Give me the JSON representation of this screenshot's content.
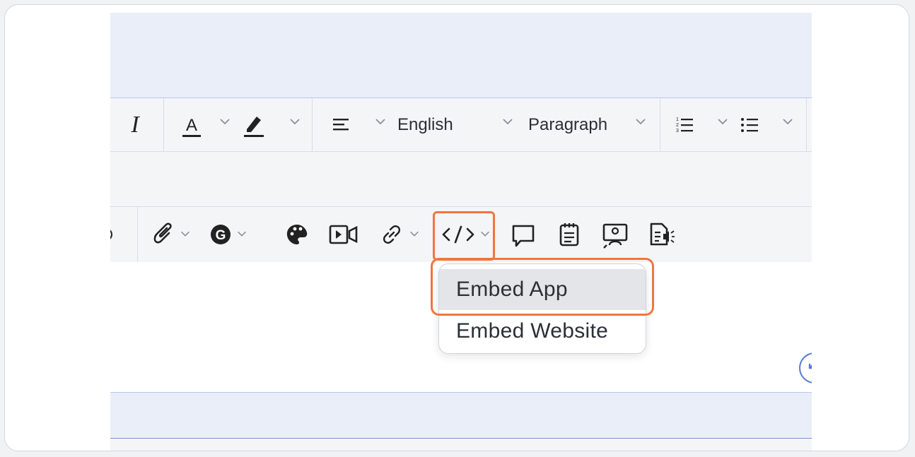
{
  "toolbar_row1": {
    "language_label": "English",
    "block_format_label": "Paragraph"
  },
  "embed_menu": {
    "items": [
      {
        "label": "Embed App",
        "highlighted": true
      },
      {
        "label": "Embed Website",
        "highlighted": false
      }
    ]
  },
  "icons": {
    "italic": "italic-icon",
    "font_color": "font-color-icon",
    "highlight_color": "highlighter-icon",
    "align": "align-left-icon",
    "ordered_list": "ordered-list-icon",
    "bullet_list": "bullet-list-icon",
    "attachment": "paperclip-icon",
    "grammar": "g-logo-icon",
    "palette": "palette-icon",
    "video": "video-icon",
    "link": "link-icon",
    "code": "code-brackets-icon",
    "comment": "comment-icon",
    "notepad": "notepad-icon",
    "presenter": "presenter-icon",
    "doc_audio": "document-audio-icon"
  },
  "colors": {
    "highlight": "#ef7640",
    "band": "#eaeef8",
    "toolbar": "#f4f5f7"
  }
}
